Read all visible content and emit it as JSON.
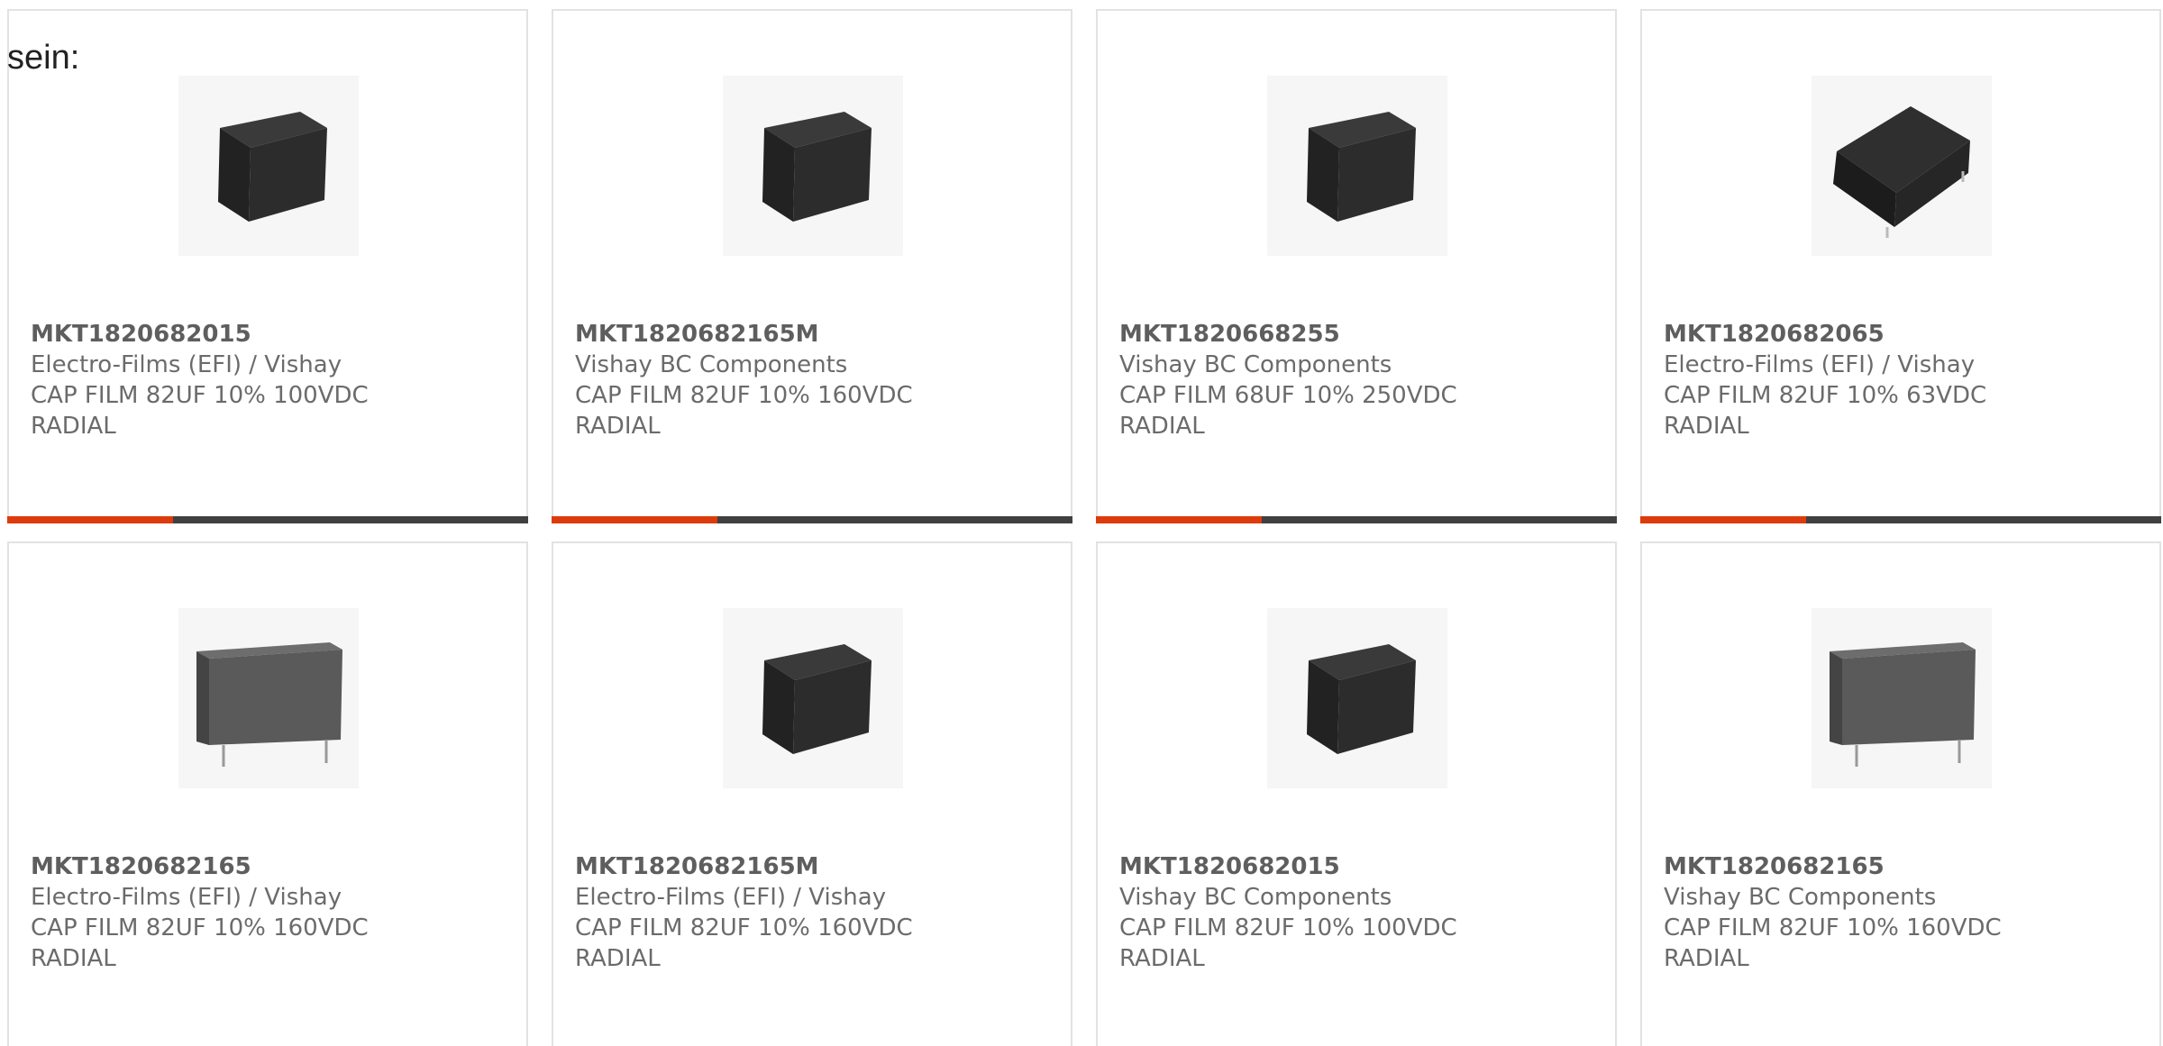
{
  "intro_text": "sein:",
  "products": [
    {
      "part": "MKT1820682015",
      "manufacturer": "Electro-Films (EFI) / Vishay",
      "desc1": "CAP FILM 82UF 10% 100VDC",
      "desc2": "RADIAL",
      "image": "black-box-capacitor-icon"
    },
    {
      "part": "MKT1820682165M",
      "manufacturer": "Vishay BC Components",
      "desc1": "CAP FILM 82UF 10% 160VDC",
      "desc2": "RADIAL",
      "image": "black-box-capacitor-icon"
    },
    {
      "part": "MKT1820668255",
      "manufacturer": "Vishay BC Components",
      "desc1": "CAP FILM 68UF 10% 250VDC",
      "desc2": "RADIAL",
      "image": "black-box-capacitor-icon"
    },
    {
      "part": "MKT1820682065",
      "manufacturer": "Electro-Films (EFI) / Vishay",
      "desc1": "CAP FILM 82UF 10% 63VDC",
      "desc2": "RADIAL",
      "image": "angled-box-capacitor-icon"
    },
    {
      "part": "MKT1820682165",
      "manufacturer": "Electro-Films (EFI) / Vishay",
      "desc1": "CAP FILM 82UF 10% 160VDC",
      "desc2": "RADIAL",
      "image": "grey-film-capacitor-icon"
    },
    {
      "part": "MKT1820682165M",
      "manufacturer": "Electro-Films (EFI) / Vishay",
      "desc1": "CAP FILM 82UF 10% 160VDC",
      "desc2": "RADIAL",
      "image": "black-box-capacitor-icon"
    },
    {
      "part": "MKT1820682015",
      "manufacturer": "Vishay BC Components",
      "desc1": "CAP FILM 82UF 10% 100VDC",
      "desc2": "RADIAL",
      "image": "black-box-capacitor-icon"
    },
    {
      "part": "MKT1820682165",
      "manufacturer": "Vishay BC Components",
      "desc1": "CAP FILM 82UF 10% 160VDC",
      "desc2": "RADIAL",
      "image": "grey-film-capacitor-icon"
    }
  ],
  "colors": {
    "accent_bar": "#dd3b0b",
    "dark_bar": "#404040",
    "card_border": "#e2e2e2",
    "text": "#6b6b6b"
  }
}
